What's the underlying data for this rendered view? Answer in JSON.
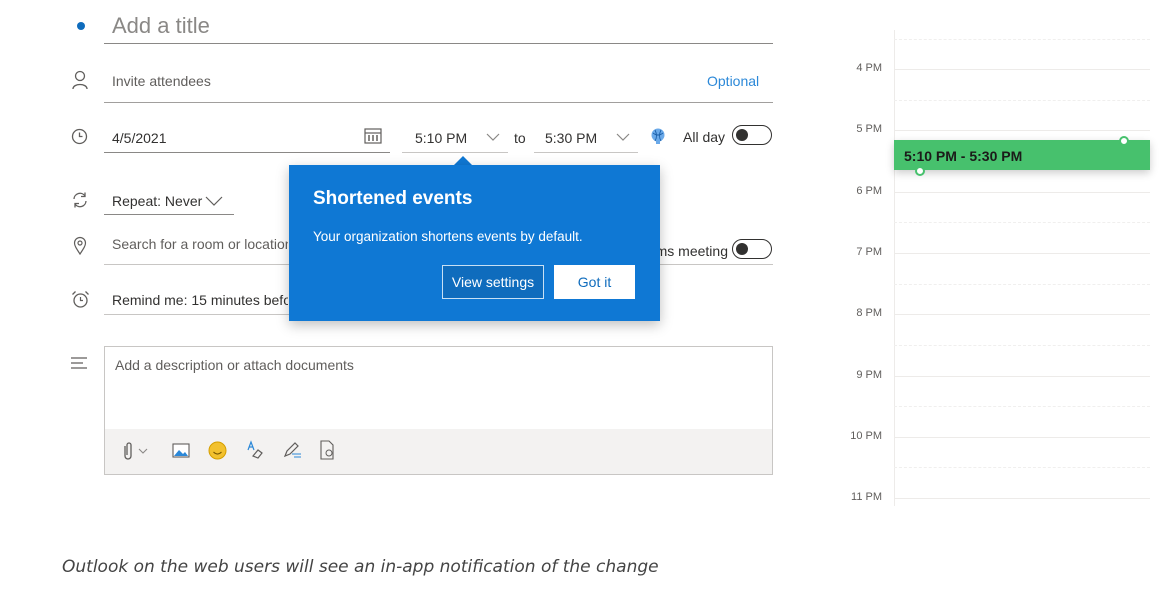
{
  "form": {
    "title_placeholder": "Add a title",
    "attendees": {
      "placeholder": "Invite attendees",
      "optional_link": "Optional"
    },
    "date": {
      "value": "4/5/2021"
    },
    "start_time": {
      "value": "5:10 PM"
    },
    "to_label": "to",
    "end_time": {
      "value": "5:30 PM"
    },
    "all_day": {
      "label": "All day",
      "on": false
    },
    "repeat": {
      "label": "Repeat: Never"
    },
    "location": {
      "placeholder": "Search for a room or location"
    },
    "teams_meeting": {
      "label": "Teams meeting",
      "on": false
    },
    "reminder": {
      "label": "Remind me: 15 minutes before"
    },
    "description": {
      "placeholder": "Add a description or attach documents"
    },
    "toolbar": [
      "attach-icon",
      "image-icon",
      "emoji-icon",
      "format-text-icon",
      "signature-icon",
      "file-icon"
    ]
  },
  "callout": {
    "title": "Shortened events",
    "body": "Your organization shortens events by default.",
    "secondary_button": "View settings",
    "primary_button": "Got it"
  },
  "calendar": {
    "hours": [
      "4 PM",
      "5 PM",
      "6 PM",
      "7 PM",
      "8 PM",
      "9 PM",
      "10 PM",
      "11 PM"
    ],
    "event": {
      "label": "5:10 PM - 5:30 PM",
      "color": "#47c16d"
    }
  },
  "caption": "Outlook on the web users will see an in-app notification of the change",
  "colors": {
    "accent": "#0f78d4",
    "event": "#47c16d",
    "link": "#2b88d8"
  }
}
